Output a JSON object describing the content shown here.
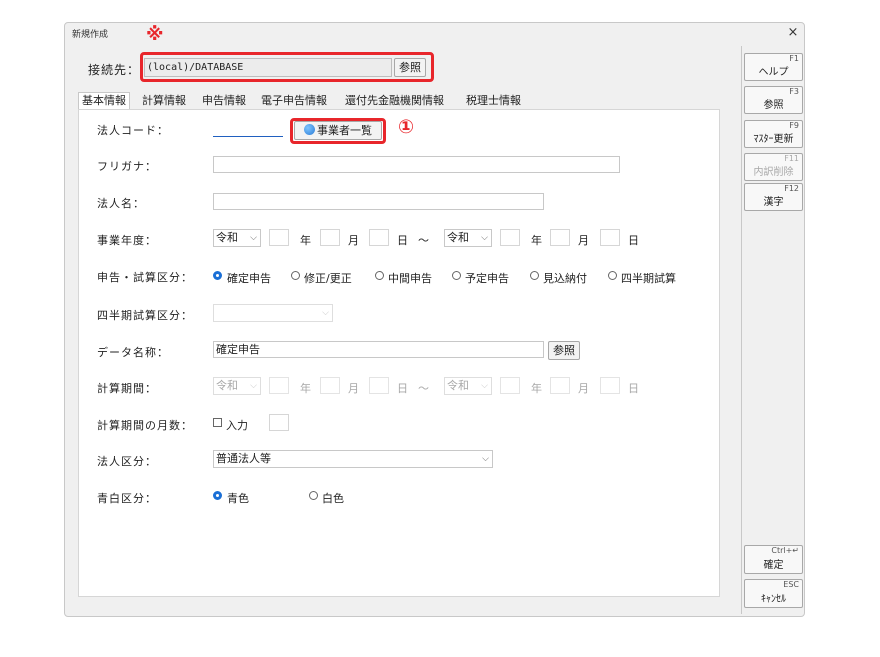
{
  "window": {
    "title": "新規作成",
    "close_label": "×"
  },
  "annotations": {
    "kome": "※",
    "circle1": "①"
  },
  "connection": {
    "label": "接続先：",
    "value": "(local)/DATABASE",
    "ref_label": "参照"
  },
  "tabs": [
    {
      "label": "基本情報",
      "active": true
    },
    {
      "label": "計算情報"
    },
    {
      "label": "申告情報"
    },
    {
      "label": "電子申告情報"
    },
    {
      "label": "還付先金融機関情報"
    },
    {
      "label": "税理士情報"
    }
  ],
  "form": {
    "corp_code": {
      "label": "法人コード：",
      "value": ""
    },
    "list_button": "事業者一覧",
    "furigana": {
      "label": "フリガナ：",
      "value": ""
    },
    "corp_name": {
      "label": "法人名：",
      "value": ""
    },
    "fiscal_year": {
      "label": "事業年度：",
      "era_start": "令和",
      "era_end": "令和",
      "year": "年",
      "month": "月",
      "day": "日",
      "tilde": "～"
    },
    "filing_type": {
      "label": "申告・試算区分：",
      "options": [
        "確定申告",
        "修正/更正",
        "中間申告",
        "予定申告",
        "見込納付",
        "四半期試算"
      ],
      "selected": "確定申告"
    },
    "quarter_type": {
      "label": "四半期試算区分：",
      "value": ""
    },
    "data_name": {
      "label": "データ名称：",
      "value": "確定申告",
      "ref_label": "参照"
    },
    "calc_period": {
      "label": "計算期間：",
      "era_start": "令和",
      "era_end": "令和",
      "year": "年",
      "month": "月",
      "day": "日",
      "tilde": "～"
    },
    "calc_months": {
      "label": "計算期間の月数：",
      "checkbox_label": "入力"
    },
    "corp_class": {
      "label": "法人区分：",
      "value": "普通法人等"
    },
    "blue_white": {
      "label": "青白区分：",
      "options": [
        "青色",
        "白色"
      ],
      "selected": "青色"
    }
  },
  "function_keys": [
    {
      "key": "F1",
      "label": "ヘルプ"
    },
    {
      "key": "F3",
      "label": "参照"
    },
    {
      "key": "F9",
      "label": "ﾏｽﾀｰ更新"
    },
    {
      "key": "F11",
      "label": "内訳削除",
      "disabled": true
    },
    {
      "key": "F12",
      "label": "漢字"
    },
    {
      "key": "Ctrl+↵",
      "label": "確定"
    },
    {
      "key": "ESC",
      "label": "ｷｬﾝｾﾙ"
    }
  ],
  "colors": {
    "accent_red": "#e8262b",
    "radio_blue": "#1a6fd6"
  }
}
